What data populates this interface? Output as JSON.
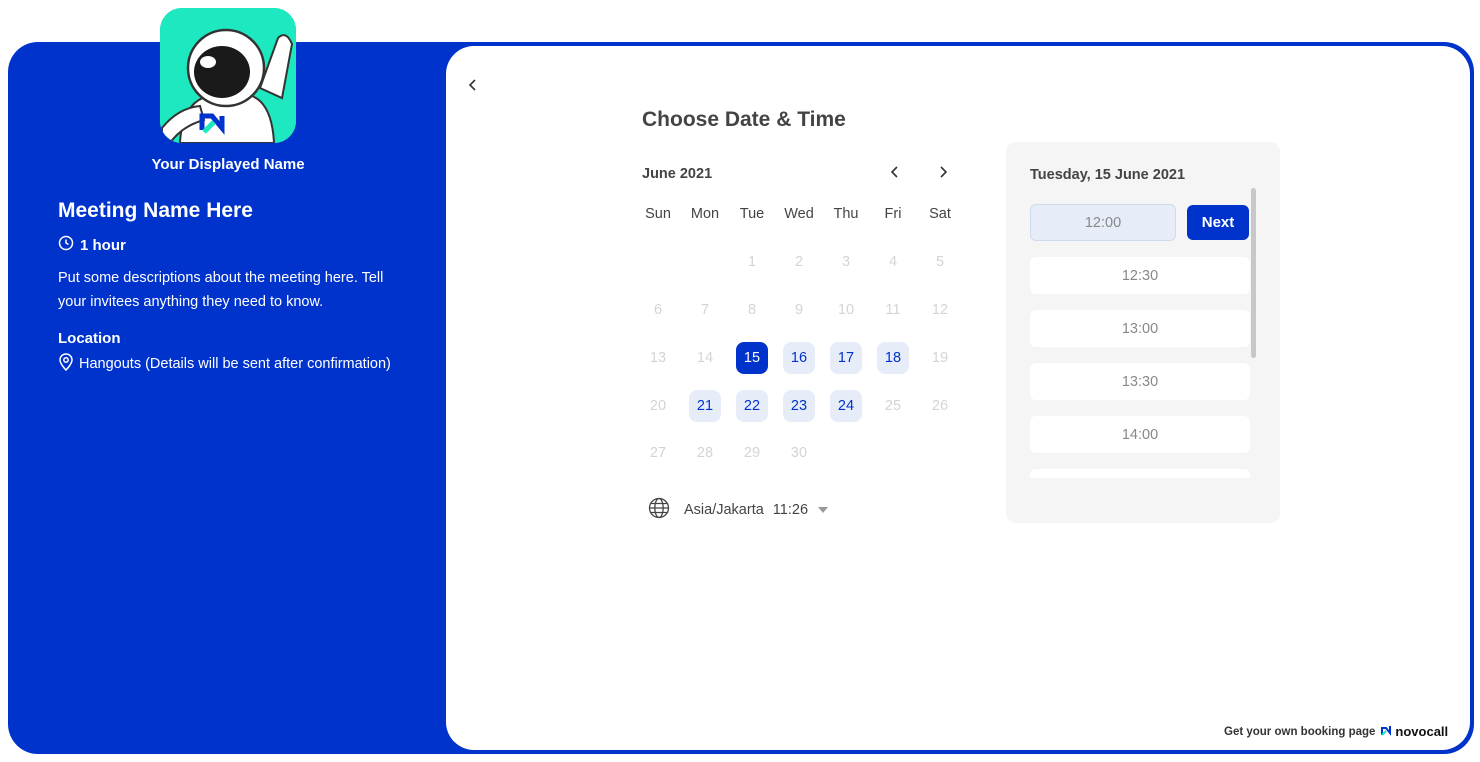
{
  "host": {
    "display_name": "Your Displayed Name"
  },
  "meeting": {
    "title": "Meeting Name Here",
    "duration": "1 hour",
    "description": "Put some descriptions about the meeting here. Tell your invitees anything they need to know.",
    "location_label": "Location",
    "location_value": "Hangouts (Details will be sent after confirmation)"
  },
  "picker": {
    "heading": "Choose Date & Time",
    "month": "June 2021",
    "weekdays": [
      "Sun",
      "Mon",
      "Tue",
      "Wed",
      "Thu",
      "Fri",
      "Sat"
    ],
    "weeks": [
      [
        null,
        null,
        {
          "d": "1",
          "s": "disabled"
        },
        {
          "d": "2",
          "s": "disabled"
        },
        {
          "d": "3",
          "s": "disabled"
        },
        {
          "d": "4",
          "s": "disabled"
        },
        {
          "d": "5",
          "s": "disabled"
        }
      ],
      [
        {
          "d": "6",
          "s": "disabled"
        },
        {
          "d": "7",
          "s": "disabled"
        },
        {
          "d": "8",
          "s": "disabled"
        },
        {
          "d": "9",
          "s": "disabled"
        },
        {
          "d": "10",
          "s": "disabled"
        },
        {
          "d": "11",
          "s": "disabled"
        },
        {
          "d": "12",
          "s": "disabled"
        }
      ],
      [
        {
          "d": "13",
          "s": "disabled"
        },
        {
          "d": "14",
          "s": "disabled"
        },
        {
          "d": "15",
          "s": "selected"
        },
        {
          "d": "16",
          "s": "available"
        },
        {
          "d": "17",
          "s": "available"
        },
        {
          "d": "18",
          "s": "available"
        },
        {
          "d": "19",
          "s": "disabled"
        }
      ],
      [
        {
          "d": "20",
          "s": "disabled"
        },
        {
          "d": "21",
          "s": "available"
        },
        {
          "d": "22",
          "s": "available"
        },
        {
          "d": "23",
          "s": "available"
        },
        {
          "d": "24",
          "s": "available"
        },
        {
          "d": "25",
          "s": "disabled"
        },
        {
          "d": "26",
          "s": "disabled"
        }
      ],
      [
        {
          "d": "27",
          "s": "disabled"
        },
        {
          "d": "28",
          "s": "disabled"
        },
        {
          "d": "29",
          "s": "disabled"
        },
        {
          "d": "30",
          "s": "disabled"
        },
        null,
        null,
        null
      ]
    ],
    "timezone": "Asia/Jakarta",
    "current_time": "11:26"
  },
  "times": {
    "selected_date": "Tuesday, 15 June 2021",
    "slots": [
      "12:00",
      "12:30",
      "13:00",
      "13:30",
      "14:00"
    ],
    "selected_slot": "12:00",
    "next_label": "Next"
  },
  "footer": {
    "text": "Get your own booking page",
    "brand": "novocall"
  },
  "colors": {
    "accent": "#0033cc",
    "avatar_bg": "#1de8c0",
    "available_bg": "#e6ecf8"
  }
}
